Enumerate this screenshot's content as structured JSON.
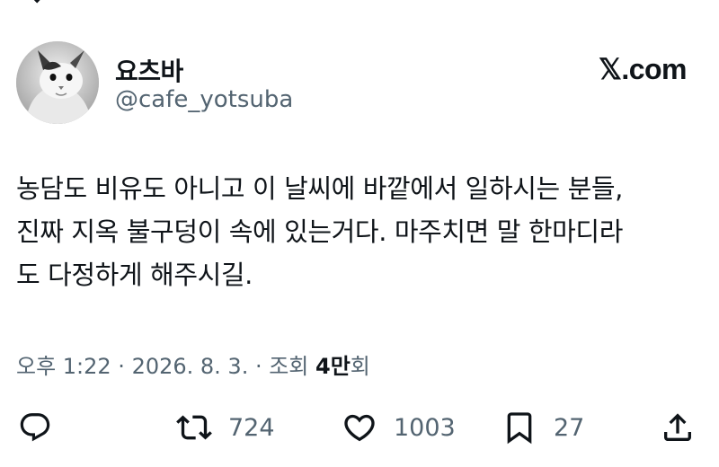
{
  "author": {
    "display_name": "요츠바",
    "handle": "@cafe_yotsuba",
    "avatar_icon": "cat-avatar"
  },
  "brand": {
    "label": "𝕏.com"
  },
  "tweet": {
    "lines": [
      "농담도 비유도 아니고 이 날씨에 바깥에서 일하시는 분들,",
      "진짜 지옥 불구덩이 속에 있는거다. 마주치면 말 한마디라",
      "도 다정하게 해주시길."
    ]
  },
  "meta": {
    "time_date": "오후 1:22 · 2026. 8. 3. · 조회 ",
    "views_count": "4만",
    "views_suffix": "회"
  },
  "actions": {
    "reply_icon": "reply-icon",
    "repost_icon": "repost-icon",
    "repost_count": "724",
    "like_icon": "heart-icon",
    "like_count": "1003",
    "bookmark_icon": "bookmark-icon",
    "bookmark_count": "27",
    "share_icon": "share-icon"
  },
  "colors": {
    "text_primary": "#0f1419",
    "text_secondary": "#536471",
    "background": "#ffffff"
  }
}
